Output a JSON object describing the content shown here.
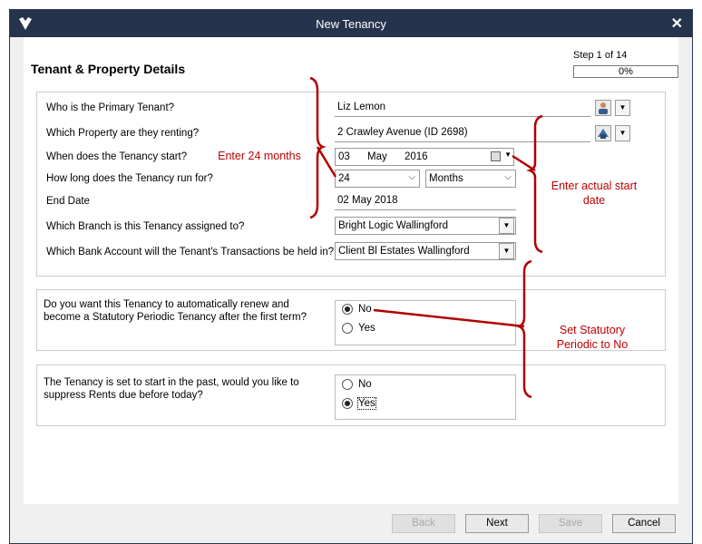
{
  "window": {
    "title": "New Tenancy"
  },
  "header": {
    "page_title": "Tenant & Property Details",
    "step": "Step 1 of 14",
    "progress": "0%"
  },
  "form": {
    "primary_tenant": {
      "label": "Who is the Primary Tenant?",
      "value": "Liz Lemon"
    },
    "property": {
      "label": "Which Property are they renting?",
      "value": "2 Crawley Avenue  (ID 2698)"
    },
    "start": {
      "label": "When does the Tenancy start?",
      "day": "03",
      "month": "May",
      "year": "2016"
    },
    "duration": {
      "label": "How long does the Tenancy run for?",
      "value": "24",
      "unit": "Months"
    },
    "end_date": {
      "label": "End Date",
      "value": "02 May 2018"
    },
    "branch": {
      "label": "Which Branch is this Tenancy assigned to?",
      "value": "Bright Logic Wallingford"
    },
    "bank": {
      "label": "Which Bank Account will the Tenant's Transactions be held in?",
      "value": "Client Bl Estates Wallingford"
    }
  },
  "renew": {
    "question": "Do you want this Tenancy to automatically renew and become a Statutory Periodic Tenancy after the first term?",
    "options": [
      "No",
      "Yes"
    ],
    "selected": "No"
  },
  "suppress": {
    "question": "The Tenancy is set to start in the past, would you like to suppress Rents due before today?",
    "options": [
      "No",
      "Yes"
    ],
    "selected": "Yes"
  },
  "annotations": {
    "months": "Enter 24 months",
    "start_date": "Enter actual start date",
    "statutory": "Set Statutory Periodic to No"
  },
  "footer": {
    "back": "Back",
    "next": "Next",
    "save": "Save",
    "cancel": "Cancel"
  },
  "colors": {
    "titlebar": "#26334d",
    "annotation": "#c00000"
  }
}
